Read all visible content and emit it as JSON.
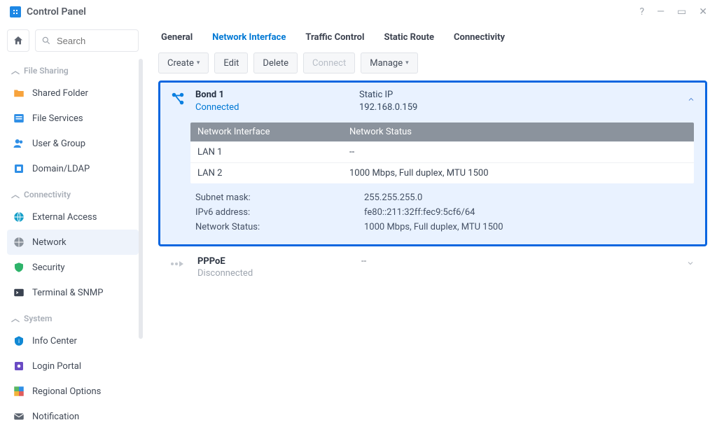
{
  "window": {
    "title": "Control Panel"
  },
  "search": {
    "placeholder": "Search"
  },
  "sections": {
    "file_sharing": {
      "label": "File Sharing",
      "items": [
        {
          "key": "shared-folder",
          "label": "Shared Folder"
        },
        {
          "key": "file-services",
          "label": "File Services"
        },
        {
          "key": "user-group",
          "label": "User & Group"
        },
        {
          "key": "domain-ldap",
          "label": "Domain/LDAP"
        }
      ]
    },
    "connectivity": {
      "label": "Connectivity",
      "items": [
        {
          "key": "external-access",
          "label": "External Access"
        },
        {
          "key": "network",
          "label": "Network"
        },
        {
          "key": "security",
          "label": "Security"
        },
        {
          "key": "terminal-snmp",
          "label": "Terminal & SNMP"
        }
      ]
    },
    "system": {
      "label": "System",
      "items": [
        {
          "key": "info-center",
          "label": "Info Center"
        },
        {
          "key": "login-portal",
          "label": "Login Portal"
        },
        {
          "key": "regional-options",
          "label": "Regional Options"
        },
        {
          "key": "notification",
          "label": "Notification"
        }
      ]
    }
  },
  "tabs": {
    "general": "General",
    "network_interface": "Network Interface",
    "traffic_control": "Traffic Control",
    "static_route": "Static Route",
    "connectivity": "Connectivity"
  },
  "toolbar": {
    "create": "Create",
    "edit": "Edit",
    "delete": "Delete",
    "connect": "Connect",
    "manage": "Manage"
  },
  "bond": {
    "name": "Bond 1",
    "status": "Connected",
    "ip_type": "Static IP",
    "ip": "192.168.0.159",
    "iface_table": {
      "head_iface": "Network Interface",
      "head_status": "Network Status",
      "rows": [
        {
          "iface": "LAN 1",
          "status": "--"
        },
        {
          "iface": "LAN 2",
          "status": "1000 Mbps, Full duplex, MTU 1500"
        }
      ]
    },
    "details": [
      {
        "label": "Subnet mask:",
        "value": "255.255.255.0"
      },
      {
        "label": "IPv6 address:",
        "value": "fe80::211:32ff:fec9:5cf6/64"
      },
      {
        "label": "Network Status:",
        "value": "1000 Mbps, Full duplex, MTU 1500"
      }
    ]
  },
  "pppoe": {
    "name": "PPPoE",
    "status": "Disconnected",
    "value": "--"
  }
}
